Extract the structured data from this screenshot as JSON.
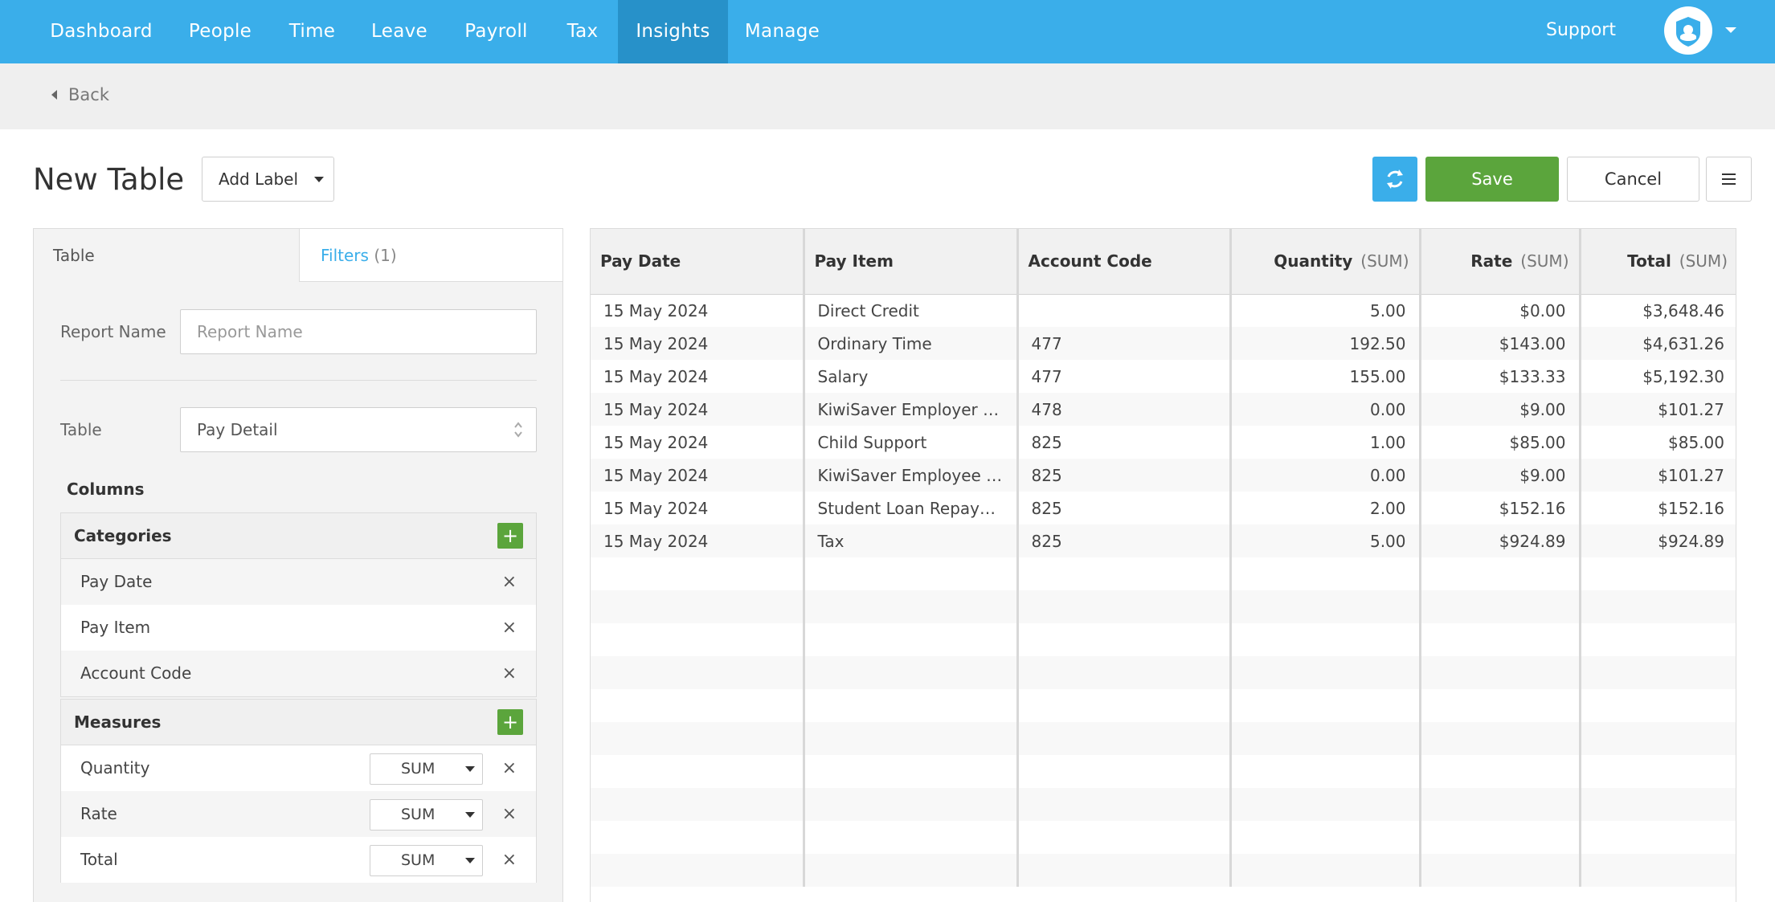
{
  "nav": {
    "items": [
      "Dashboard",
      "People",
      "Time",
      "Leave",
      "Payroll",
      "Tax",
      "Insights",
      "Manage"
    ],
    "active": "Insights",
    "support": "Support"
  },
  "colors": {
    "brand": "#3aaeea",
    "brand_active": "#2791c9",
    "success": "#5ba53c"
  },
  "back": {
    "label": "Back"
  },
  "header": {
    "title": "New Table",
    "add_label": "Add Label",
    "save": "Save",
    "cancel": "Cancel"
  },
  "left_panel": {
    "tabs": {
      "table": "Table",
      "filters": "Filters",
      "filters_count": "(1)"
    },
    "report_name": {
      "label": "Report Name",
      "placeholder": "Report Name",
      "value": ""
    },
    "table_select": {
      "label": "Table",
      "value": "Pay Detail"
    },
    "columns_heading": "Columns",
    "categories": {
      "heading": "Categories",
      "items": [
        "Pay Date",
        "Pay Item",
        "Account Code"
      ]
    },
    "measures": {
      "heading": "Measures",
      "items": [
        {
          "label": "Quantity",
          "agg": "SUM"
        },
        {
          "label": "Rate",
          "agg": "SUM"
        },
        {
          "label": "Total",
          "agg": "SUM"
        }
      ]
    },
    "icons": {
      "add": "+",
      "remove": "×"
    }
  },
  "table": {
    "columns": [
      {
        "label": "Pay Date",
        "agg": ""
      },
      {
        "label": "Pay Item",
        "agg": ""
      },
      {
        "label": "Account Code",
        "agg": ""
      },
      {
        "label": "Quantity",
        "agg": "(SUM)"
      },
      {
        "label": "Rate",
        "agg": "(SUM)"
      },
      {
        "label": "Total",
        "agg": "(SUM)"
      }
    ],
    "rows": [
      [
        "15 May 2024",
        "Direct Credit",
        "",
        "5.00",
        "$0.00",
        "$3,648.46"
      ],
      [
        "15 May 2024",
        "Ordinary Time",
        "477",
        "192.50",
        "$143.00",
        "$4,631.26"
      ],
      [
        "15 May 2024",
        "Salary",
        "477",
        "155.00",
        "$133.33",
        "$5,192.30"
      ],
      [
        "15 May 2024",
        "KiwiSaver Employer Co...",
        "478",
        "0.00",
        "$9.00",
        "$101.27"
      ],
      [
        "15 May 2024",
        "Child Support",
        "825",
        "1.00",
        "$85.00",
        "$85.00"
      ],
      [
        "15 May 2024",
        "KiwiSaver Employee D...",
        "825",
        "0.00",
        "$9.00",
        "$101.27"
      ],
      [
        "15 May 2024",
        "Student Loan Repaym...",
        "825",
        "2.00",
        "$152.16",
        "$152.16"
      ],
      [
        "15 May 2024",
        "Tax",
        "825",
        "5.00",
        "$924.89",
        "$924.89"
      ]
    ],
    "empty_rows": 10
  }
}
